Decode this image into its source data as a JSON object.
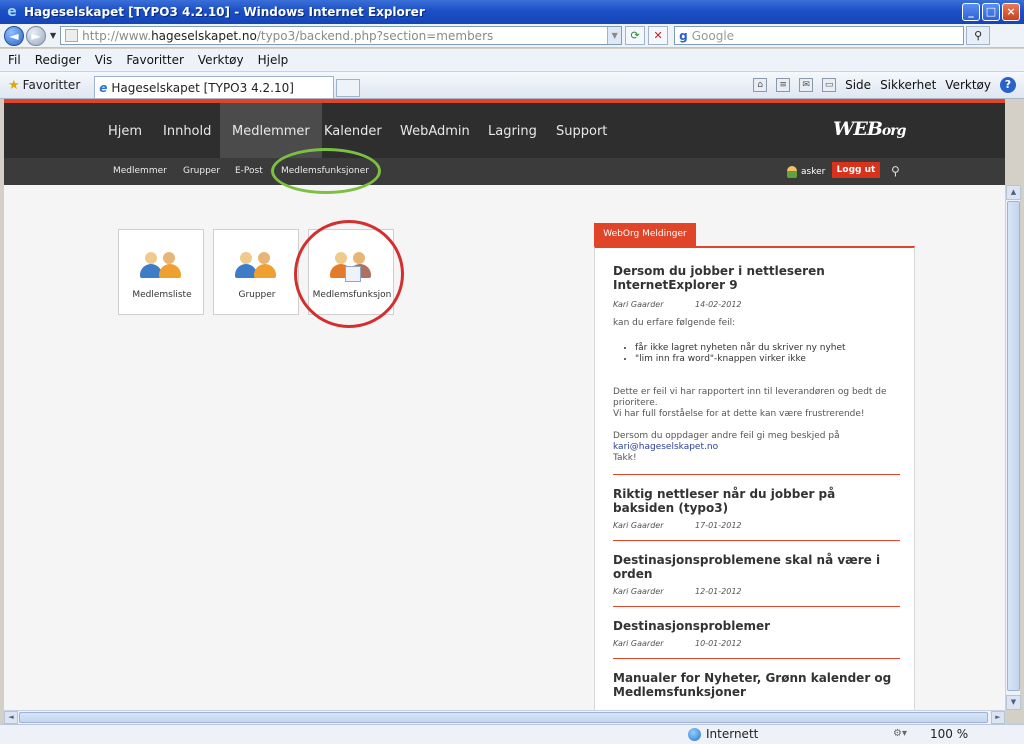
{
  "window": {
    "title": "Hageselskapet [TYPO3 4.2.10] - Windows Internet Explorer"
  },
  "address": {
    "url_prefix": "http://www.",
    "url_host": "hageselskapet.no",
    "url_path": "/typo3/backend.php?section=members",
    "search_placeholder": "Google"
  },
  "menu": [
    "Fil",
    "Rediger",
    "Vis",
    "Favoritter",
    "Verktøy",
    "Hjelp"
  ],
  "favorites_label": "Favoritter",
  "tab": {
    "title": "Hageselskapet [TYPO3 4.2.10]"
  },
  "commandbar": {
    "page": "Side",
    "safety": "Sikkerhet",
    "tools": "Verktøy",
    "help": "?"
  },
  "site": {
    "logo_we": "WEB",
    "logo_org": "org",
    "mainnav": [
      "Hjem",
      "Innhold",
      "Medlemmer",
      "Kalender",
      "WebAdmin",
      "Lagring",
      "Support"
    ],
    "active_mainnav": "Medlemmer",
    "subnav": [
      "Medlemmer",
      "Grupper",
      "E-Post",
      "Medlemsfunksjoner"
    ],
    "user": "asker",
    "logout": "Logg ut"
  },
  "tiles": [
    {
      "label": "Medlemsliste"
    },
    {
      "label": "Grupper"
    },
    {
      "label": "Medlemsfunksjon"
    }
  ],
  "messages": {
    "tab_label": "WebOrg Meldinger",
    "items": [
      {
        "title": "Dersom du jobber i nettleseren InternetExplorer 9",
        "author": "Kari Gaarder",
        "date": "14-02-2012",
        "intro": "kan du erfare følgende feil:",
        "bullets": [
          "får ikke lagret nyheten når du skriver ny nyhet",
          "\"lim inn fra word\"-knappen virker ikke"
        ],
        "para1": "Dette er feil vi har rapportert inn til leverandøren og bedt de prioritere.",
        "para2": "Vi har full forståelse for at dette kan være frustrerende!",
        "para3": "Dersom du oppdager andre feil gi meg beskjed på",
        "email": "kari@hageselskapet.no",
        "thanks": "Takk!"
      },
      {
        "title": "Riktig nettleser når du jobber på baksiden (typo3)",
        "author": "Kari Gaarder",
        "date": "17-01-2012"
      },
      {
        "title": "Destinasjonsproblemene skal nå være i orden",
        "author": "Kari Gaarder",
        "date": "12-01-2012"
      },
      {
        "title": "Destinasjonsproblemer",
        "author": "Kari Gaarder",
        "date": "10-01-2012"
      },
      {
        "title": "Manualer for Nyheter, Grønn kalender og Medlemsfunksjoner"
      }
    ]
  },
  "status": {
    "zone": "Internett",
    "zoom": "100 %"
  },
  "colors": {
    "accent": "#e0452a",
    "nav_bg": "#2e2e2e",
    "highlight_green": "#7bc043",
    "highlight_red": "#d32f2f"
  }
}
